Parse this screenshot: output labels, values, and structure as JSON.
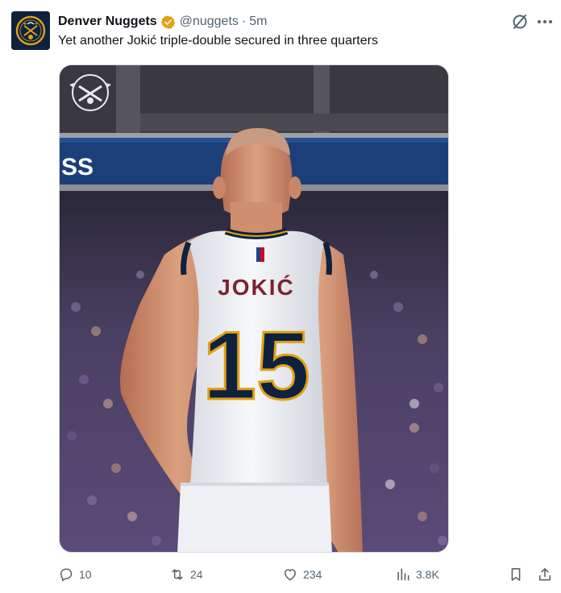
{
  "tweet": {
    "author": {
      "display_name": "Denver Nuggets",
      "handle": "@nuggets",
      "separator": "·",
      "time": "5m",
      "verified": true,
      "verified_color": "#e2a013",
      "avatar_icon": "nuggets-logo-icon"
    },
    "text": "Yet another Jokić triple-double secured in three quarters",
    "media": {
      "jersey_name": "JOKIĆ",
      "jersey_number": "15",
      "signage_text": "SS",
      "jersey_color": "#f4f5f7",
      "trim_color": "#0e2240",
      "gold_color": "#e2a013"
    },
    "actions": {
      "replies": "10",
      "reposts": "24",
      "likes": "234",
      "views": "3.8K"
    },
    "icons": {
      "grok": "grok-icon",
      "more": "more-dots-icon",
      "reply": "reply-icon",
      "repost": "repost-icon",
      "like": "heart-icon",
      "views": "views-bar-chart-icon",
      "bookmark": "bookmark-icon",
      "share": "share-icon"
    }
  }
}
